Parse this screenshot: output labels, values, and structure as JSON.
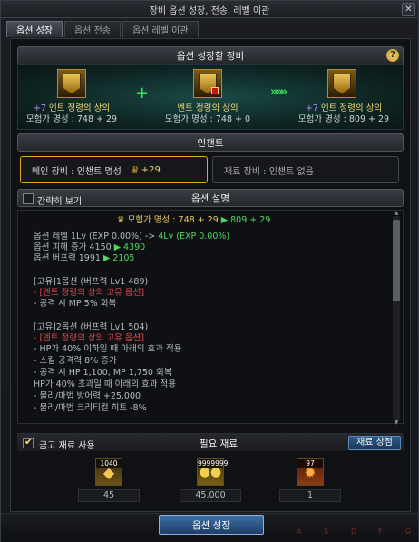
{
  "window": {
    "title": "장비 옵션 성장, 전송, 레벨 이관",
    "close_glyph": "✕"
  },
  "tabs": [
    {
      "label": "옵션 성장",
      "active": true
    },
    {
      "label": "옵션 전송",
      "active": false
    },
    {
      "label": "옵션 레벨 이관",
      "active": false
    }
  ],
  "growth": {
    "header": "옵션 성장할 장비",
    "help": "?",
    "plus": "+",
    "arrow": "»»»",
    "left": {
      "upgrade": "+7",
      "name": "엔트 정령의 상의",
      "fame": "모험가 명성 : 748 + 29"
    },
    "middle": {
      "name": "엔트 정령의 상의",
      "fame": "모험가 명성 : 748 + 0"
    },
    "right": {
      "upgrade": "+7",
      "name": "엔트 정령의 상의",
      "fame": "모험가 명성 : 809 + 29"
    }
  },
  "enchant": {
    "header": "인챈트",
    "main_label": "메인 장비 : 인챈트 명성",
    "main_value": "+29",
    "sub_label": "재료 장비 : 인챈트 없음"
  },
  "options": {
    "header": "옵션 설명",
    "brief_label": "간략히 보기",
    "brief_checked": false,
    "fame_line": {
      "prefix": "모험가 명성 : 748 + 29",
      "arrow": "▶",
      "result": "809 + 29"
    },
    "lines": [
      {
        "text": "옵션 레벨 1Lv (EXP 0.00%) -> ",
        "highlight": "4Lv (EXP 0.00%)",
        "style": "green"
      },
      {
        "text": "옵션 피해 증가 4150 ",
        "arrow": "▶",
        "highlight": "4390",
        "style": "green"
      },
      {
        "text": "옵션 버프력 1991 ",
        "arrow": "▶",
        "highlight": "2105",
        "style": "green"
      },
      {
        "text": ""
      },
      {
        "text": "[고유]1옵션 (버프력 Lv1 489)"
      },
      {
        "text": "- [엔트 정령의 상의 고유 옵션]",
        "style": "red"
      },
      {
        "text": "- 공격 시 MP 5% 회복"
      },
      {
        "text": ""
      },
      {
        "text": "[고유]2옵션 (버프력 Lv1 504)"
      },
      {
        "text": "- [엔트 정령의 상의 고유 옵션]",
        "style": "red"
      },
      {
        "text": "- HP가 40% 이하일 때 아래의 효과 적용"
      },
      {
        "text": "  - 스킬 공격력 8% 증가"
      },
      {
        "text": "  - 공격 시 HP 1,100, MP 1,750 회복"
      },
      {
        "text": "  HP가 40% 초과일 때 아래의 효과 적용"
      },
      {
        "text": "  - 물리/마법 방어력 +25,000"
      },
      {
        "text": "  - 물리/마법 크리티컬 히트 -8%"
      }
    ]
  },
  "materials": {
    "header": "필요 재료",
    "storage_label": "금고 재료 사용",
    "storage_checked": true,
    "shop_button": "재료 상점",
    "items": [
      {
        "badge": "1040",
        "count": "45",
        "icon": "crystal-icon",
        "color": "#caa24a"
      },
      {
        "badge": "9999999",
        "count": "45,000",
        "icon": "gold-coins-icon",
        "color": "#d8b23a"
      },
      {
        "badge": "97",
        "count": "1",
        "icon": "burst-icon",
        "color": "#d66a2a"
      }
    ]
  },
  "bottom": {
    "grow_button": "옵션 성장",
    "slot_letters": [
      "A",
      "S",
      "D",
      "F",
      "G"
    ]
  }
}
